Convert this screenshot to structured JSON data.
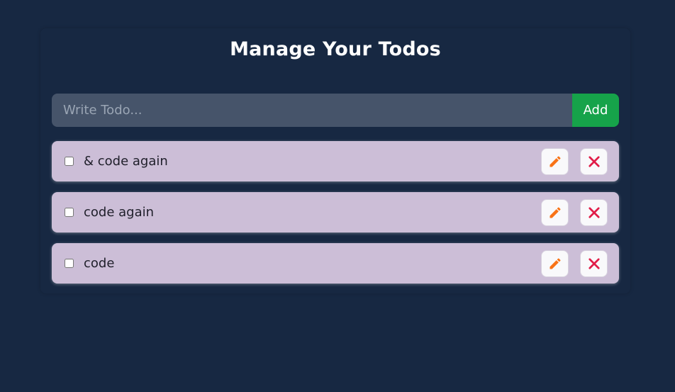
{
  "header": {
    "title": "Manage Your Todos"
  },
  "form": {
    "placeholder": "Write Todo...",
    "value": "",
    "add_label": "Add"
  },
  "todos": [
    {
      "text": "& code again",
      "completed": false
    },
    {
      "text": "code again",
      "completed": false
    },
    {
      "text": "code",
      "completed": false
    }
  ],
  "icons": {
    "edit": "pencil-icon",
    "delete": "close-icon"
  },
  "colors": {
    "background": "#172842",
    "input": "#46546a",
    "add_button": "#16a34a",
    "todo_item": "#ccbed7",
    "edit_icon": "#f97316",
    "delete_icon": "#e11d48"
  }
}
